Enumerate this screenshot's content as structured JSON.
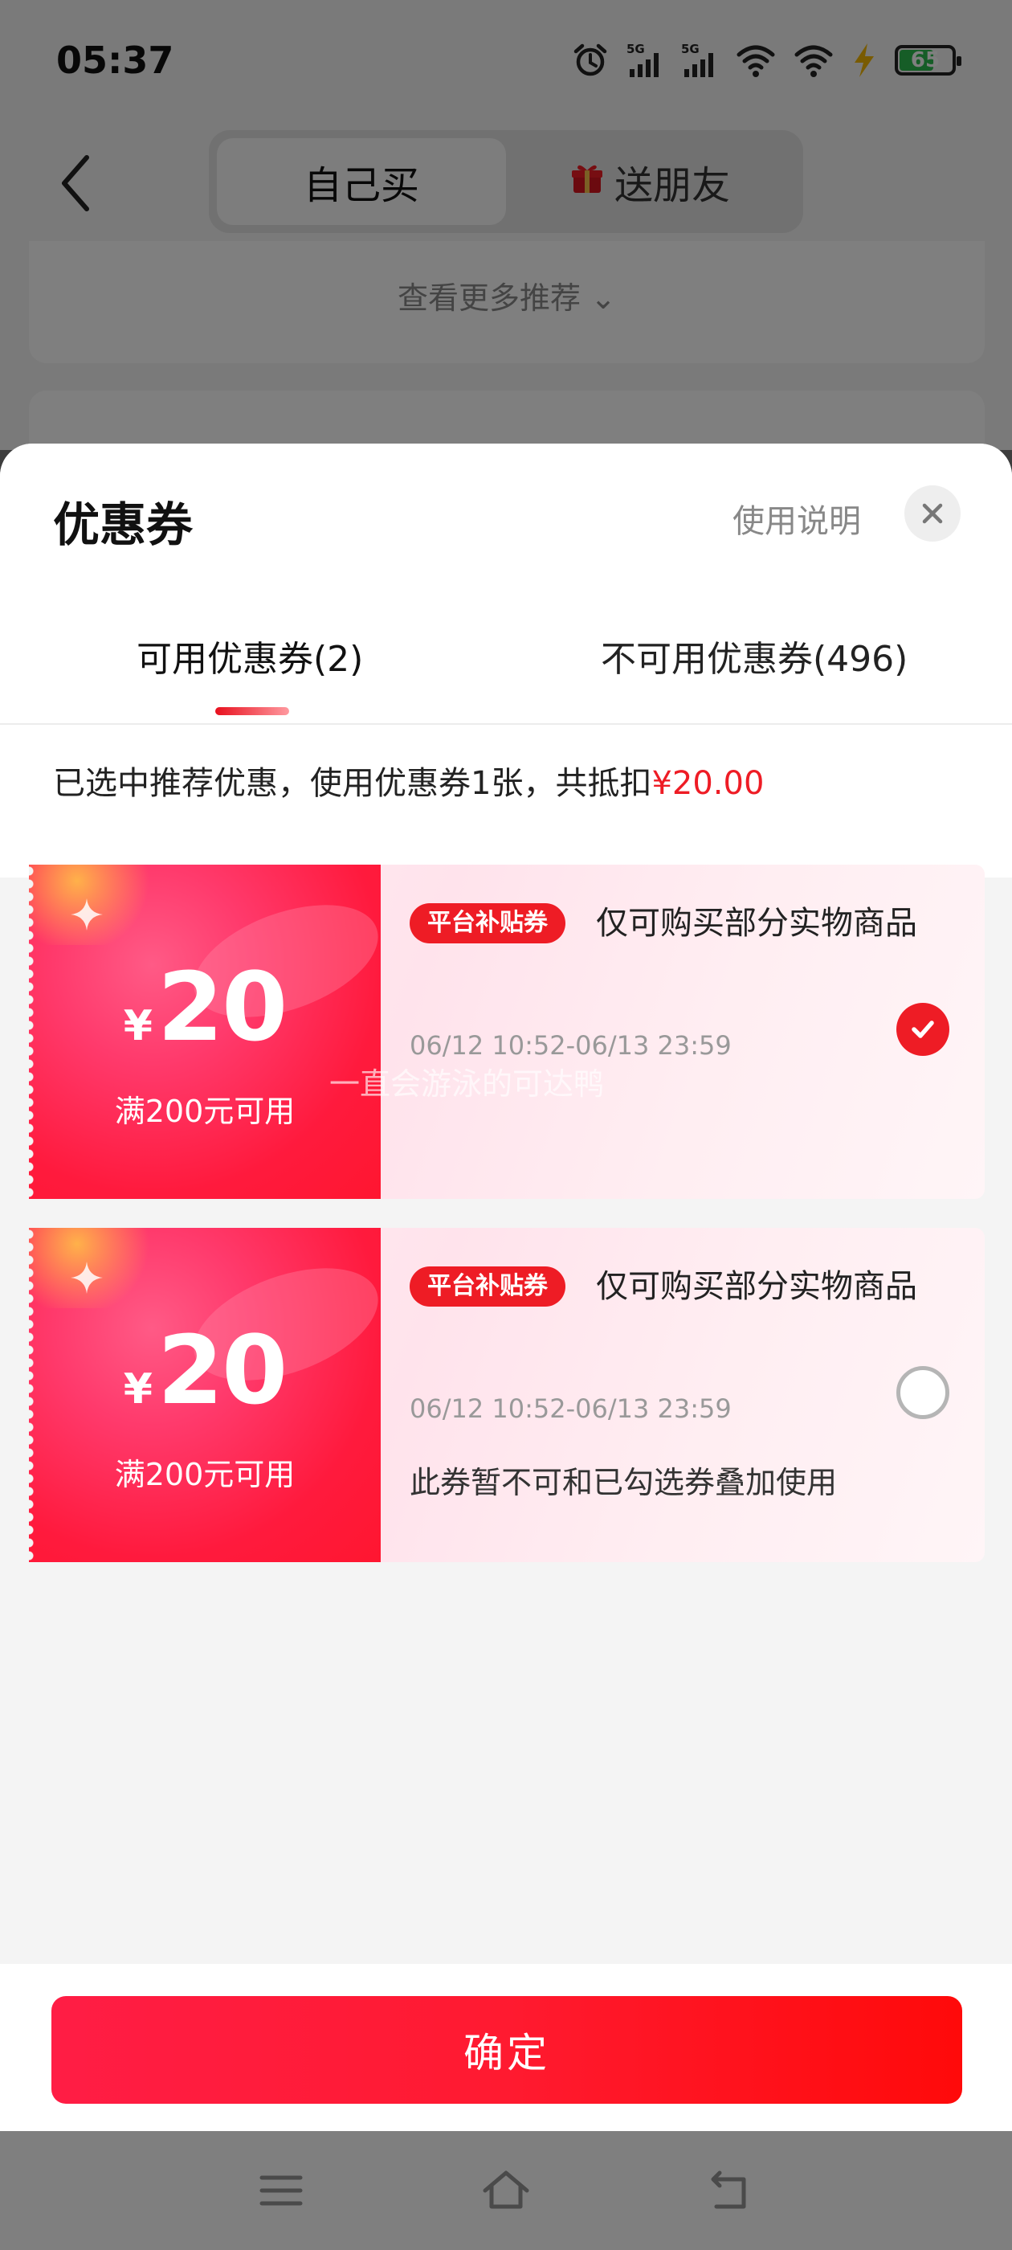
{
  "status_bar": {
    "time": "05:37",
    "battery": "65",
    "icons": [
      "alarm-icon",
      "signal-5g-icon",
      "signal-5g-icon",
      "wifi-icon",
      "wifi-icon",
      "charging-icon",
      "battery-icon"
    ],
    "network_labels": [
      "5G",
      "5G"
    ]
  },
  "header": {
    "tabs": [
      {
        "label": "自己买",
        "active": true
      },
      {
        "label": "送朋友",
        "active": false,
        "icon": "gift-icon"
      }
    ]
  },
  "background": {
    "more_recommend": "查看更多推荐"
  },
  "sheet": {
    "title": "优惠券",
    "usage_link": "使用说明",
    "tabs": [
      {
        "label": "可用优惠券(2)",
        "active": true
      },
      {
        "label": "不可用优惠券(496)",
        "active": false
      }
    ],
    "summary_prefix": "已选中推荐优惠，使用优惠券1张，共抵扣",
    "summary_amount": "¥20.00",
    "coupons": [
      {
        "currency": "¥",
        "amount": "20",
        "condition": "满200元可用",
        "tag": "平台补贴券",
        "title": "仅可购买部分实物商品",
        "validity": "06/12 10:52-06/13 23:59",
        "note": "",
        "selected": true
      },
      {
        "currency": "¥",
        "amount": "20",
        "condition": "满200元可用",
        "tag": "平台补贴券",
        "title": "仅可购买部分实物商品",
        "validity": "06/12 10:52-06/13 23:59",
        "note": "此券暂不可和已勾选券叠加使用",
        "selected": false
      }
    ],
    "watermark": "一直会游泳的可达鸭",
    "confirm_label": "确定"
  },
  "colors": {
    "accent": "#ee1c25",
    "button_gradient_start": "#ff1d45",
    "button_gradient_end": "#ff0a0a"
  },
  "nav_bar": {
    "icons": [
      "menu-icon",
      "home-icon",
      "back-icon"
    ]
  }
}
